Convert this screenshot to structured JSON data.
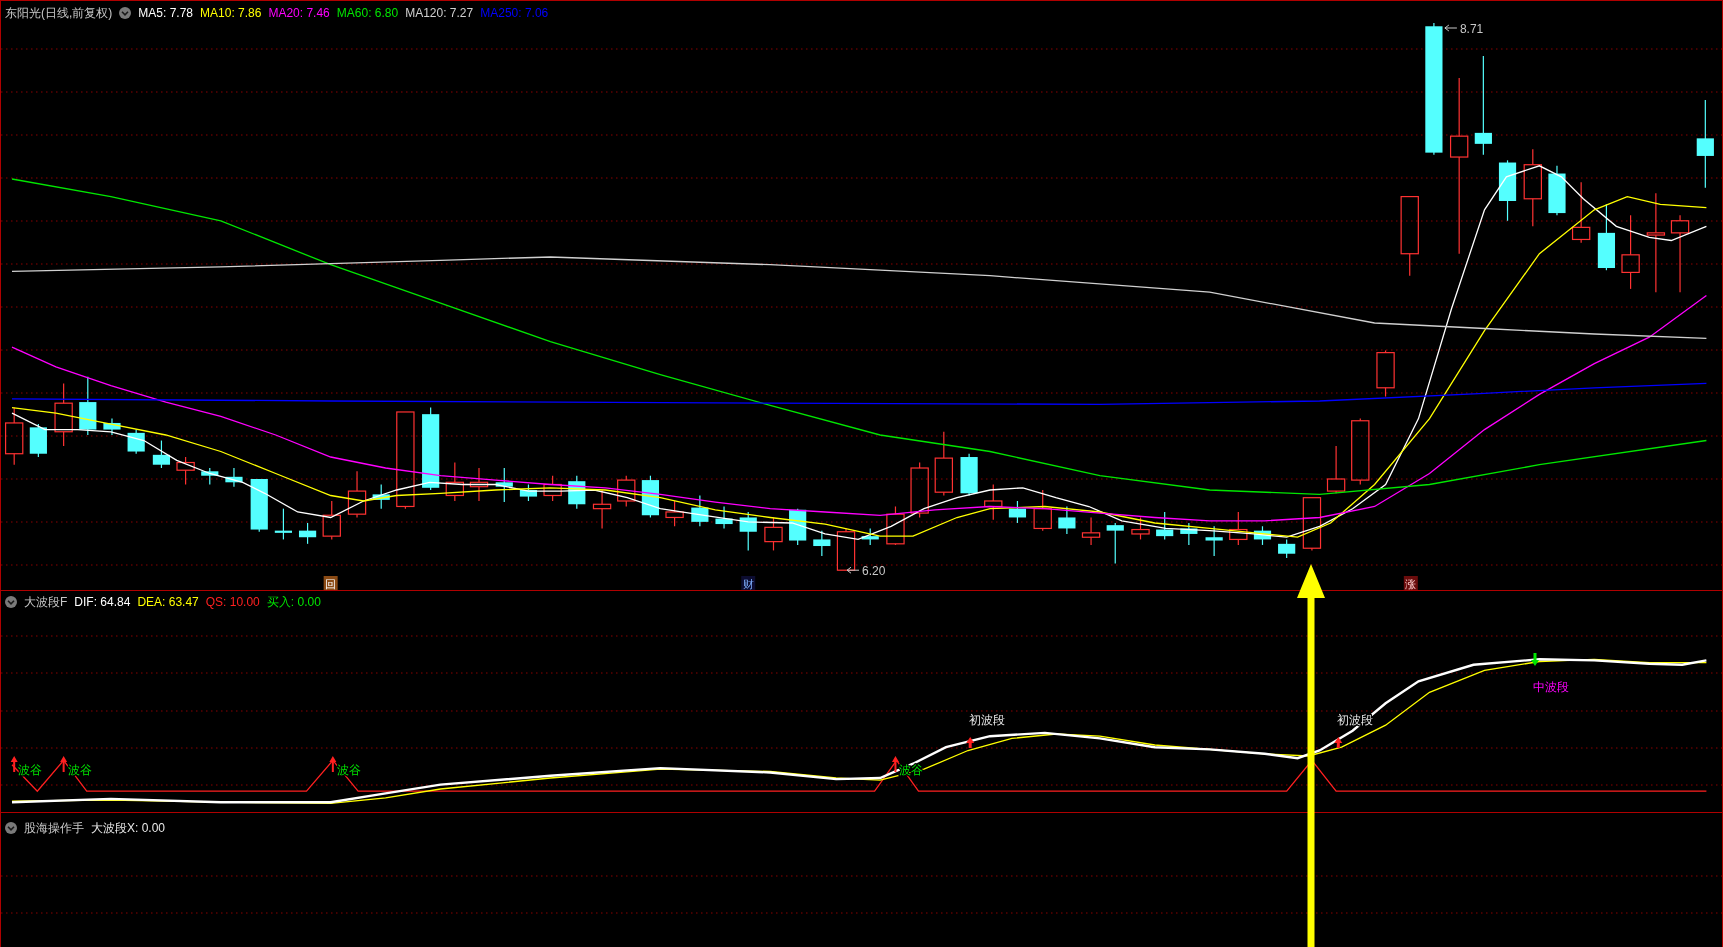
{
  "main_chart": {
    "title": "东阳光(日线,前复权)",
    "moving_averages": [
      {
        "label": "MA5: 7.78",
        "color": "#ffffff"
      },
      {
        "label": "MA10: 7.86",
        "color": "#ffff00"
      },
      {
        "label": "MA20: 7.46",
        "color": "#ff00ff"
      },
      {
        "label": "MA60: 6.80",
        "color": "#00e600"
      },
      {
        "label": "MA120: 7.27",
        "color": "#d0d0d0"
      },
      {
        "label": "MA250: 7.06",
        "color": "#0000ff"
      }
    ],
    "high_label": "8.71",
    "low_label": "6.20",
    "markers": [
      {
        "kind": "review",
        "text": "回"
      },
      {
        "kind": "finance",
        "text": "财"
      },
      {
        "kind": "limit_up",
        "text": "涨"
      }
    ]
  },
  "indicator_pane": {
    "title": "大波段F",
    "values": [
      {
        "label": "DIF: 64.84",
        "color": "#ffffff"
      },
      {
        "label": "DEA: 63.47",
        "color": "#ffff00"
      },
      {
        "label": "QS: 10.00",
        "color": "#ff2020"
      },
      {
        "label": "买入: 0.00",
        "color": "#00e600"
      }
    ],
    "signals": [
      {
        "kind": "trough",
        "label": "波谷"
      },
      {
        "kind": "trough",
        "label": "波谷"
      },
      {
        "kind": "trough",
        "label": "波谷"
      },
      {
        "kind": "trough",
        "label": "波谷"
      },
      {
        "kind": "wave_start",
        "label": "初波段"
      },
      {
        "kind": "wave_start",
        "label": "初波段"
      },
      {
        "kind": "mid_wave",
        "label": "中波段"
      }
    ]
  },
  "bottom_pane": {
    "title": "股海操作手",
    "value": "大波段X: 0.00"
  }
}
